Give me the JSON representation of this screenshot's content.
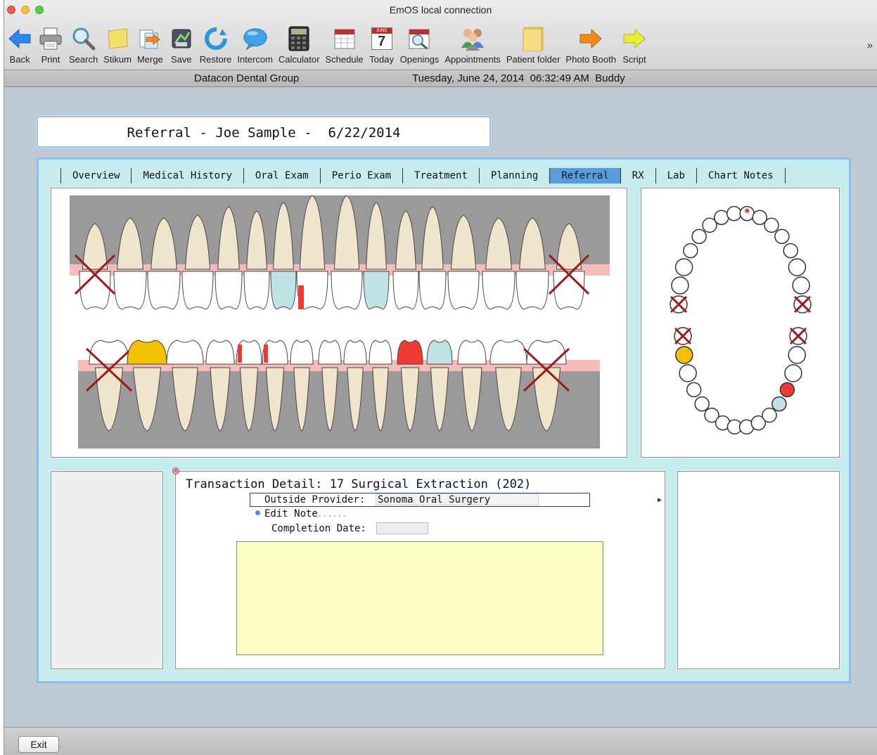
{
  "window": {
    "title": "EmOS local connection"
  },
  "toolbar": {
    "items": [
      {
        "label": "Back",
        "icon": "back-arrow-icon"
      },
      {
        "label": "Print",
        "icon": "printer-icon"
      },
      {
        "label": "Search",
        "icon": "magnifier-icon"
      },
      {
        "label": "Stikum",
        "icon": "sticky-note-icon"
      },
      {
        "label": "Merge",
        "icon": "merge-icon"
      },
      {
        "label": "Save",
        "icon": "save-icon"
      },
      {
        "label": "Restore",
        "icon": "restore-icon"
      },
      {
        "label": "Intercom",
        "icon": "chat-bubble-icon"
      },
      {
        "label": "Calculator",
        "icon": "calculator-icon"
      },
      {
        "label": "Schedule",
        "icon": "calendar-icon"
      },
      {
        "label": "Today",
        "icon": "calendar-today-icon"
      },
      {
        "label": "Openings",
        "icon": "calendar-search-icon"
      },
      {
        "label": "Appointments",
        "icon": "people-icon"
      },
      {
        "label": "Patient folder",
        "icon": "folder-icon"
      },
      {
        "label": "Photo Booth",
        "icon": "orange-arrow-icon"
      },
      {
        "label": "Script",
        "icon": "yellow-arrow-icon"
      }
    ],
    "today_day": "7",
    "today_month": "JUNE",
    "overflow": "»"
  },
  "status": {
    "org": "Datacon Dental Group",
    "datetime": "Tuesday, June 24, 2014  06:32:49 AM  Buddy"
  },
  "referral_header": "Referral - Joe Sample -  6/22/2014",
  "tabs": [
    {
      "label": "Overview",
      "active": false
    },
    {
      "label": "Medical History",
      "active": false
    },
    {
      "label": "Oral Exam",
      "active": false
    },
    {
      "label": "Perio Exam",
      "active": false
    },
    {
      "label": "Treatment",
      "active": false
    },
    {
      "label": "Planning",
      "active": false
    },
    {
      "label": "Referral",
      "active": true
    },
    {
      "label": "RX",
      "active": false
    },
    {
      "label": "Lab",
      "active": false
    },
    {
      "label": "Chart Notes",
      "active": false
    }
  ],
  "transaction": {
    "title": "Transaction Detail: 17 Surgical Extraction (202)",
    "provider_label": "Outside Provider:",
    "provider_value": "Sonoma Oral Surgery",
    "edit_note": "Edit Note",
    "edit_dots": "......",
    "completion_label": "Completion Date:",
    "completion_value": "",
    "note_text": ""
  },
  "colors": {
    "gum": "#f6bcbc",
    "tooth": "#f1e4cc",
    "crown": "#ffffff",
    "restoration_red": "#ef3b34",
    "restoration_gold": "#f2c200",
    "sealant_blue": "#bfe3e5",
    "extraction_x": "#9b1b1b",
    "bone": "#9a9a9a",
    "active_tab": "#5b9bd9"
  },
  "footer": {
    "exit_label": "Exit"
  }
}
